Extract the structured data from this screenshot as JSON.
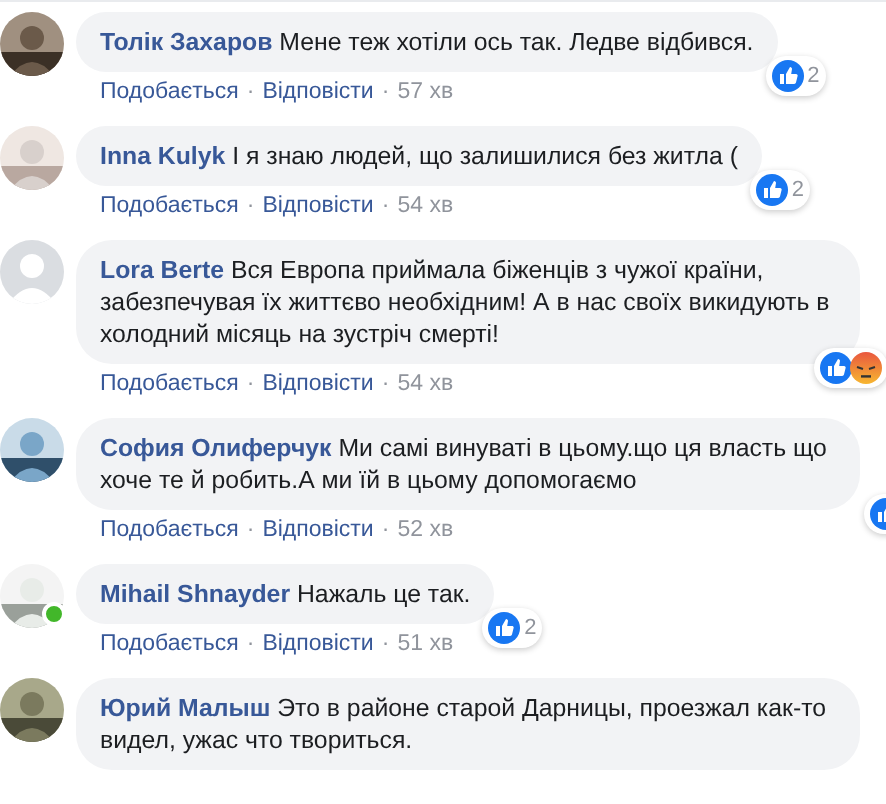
{
  "comments": [
    {
      "author": "Толік Захаров",
      "text": "Мене теж хотіли ось так. Ледве відбився.",
      "online": false,
      "reactions": [
        {
          "kind": "like"
        }
      ],
      "reaction_count": "2",
      "actions": [
        "Подобається",
        "Відповісти"
      ],
      "separators": [
        "·",
        "·"
      ],
      "time": "57 хв"
    },
    {
      "author": "Inna Kulyk",
      "text": "І я знаю людей, що залишилися без житла (",
      "online": false,
      "reactions": [
        {
          "kind": "like"
        }
      ],
      "reaction_count": "2",
      "actions": [
        "Подобається",
        "Відповісти"
      ],
      "separators": [
        "·",
        "·"
      ],
      "time": "54 хв"
    },
    {
      "author": "Lora Berte",
      "text": "Вся Европа приймала біженців з чужої країни, забезпечувая їх життєво необхідним! А в нас своїх викидують в холодний місяць на зустріч смерті!",
      "kind": "silhouette",
      "online": false,
      "reactions": [
        {
          "kind": "like"
        },
        {
          "kind": "angry"
        }
      ],
      "actions": [
        "Подобається",
        "Відповісти"
      ],
      "separators": [
        "·",
        "·"
      ],
      "time": "54 хв"
    },
    {
      "author": "София Олиферчук",
      "text": "Ми самі винуваті в цьому.що ця власть що хоче те й робить.А ми їй в цьому допомогаємо",
      "online": false,
      "reactions": [
        {
          "kind": "like"
        }
      ],
      "actions": [
        "Подобається",
        "Відповісти"
      ],
      "separators": [
        "·",
        "·"
      ],
      "time": "52 хв"
    },
    {
      "author": "Mihail Shnayder",
      "text": "Нажаль це так.",
      "online": true,
      "reactions": [
        {
          "kind": "like"
        }
      ],
      "reaction_count": "2",
      "actions": [
        "Подобається",
        "Відповісти"
      ],
      "separators": [
        "·",
        "·"
      ],
      "time": "51 хв"
    },
    {
      "author": "Юрий Малыш",
      "text": "Это в районе старой Дарницы, проезжал как-то видел, ужас что твориться.",
      "online": false
    }
  ]
}
